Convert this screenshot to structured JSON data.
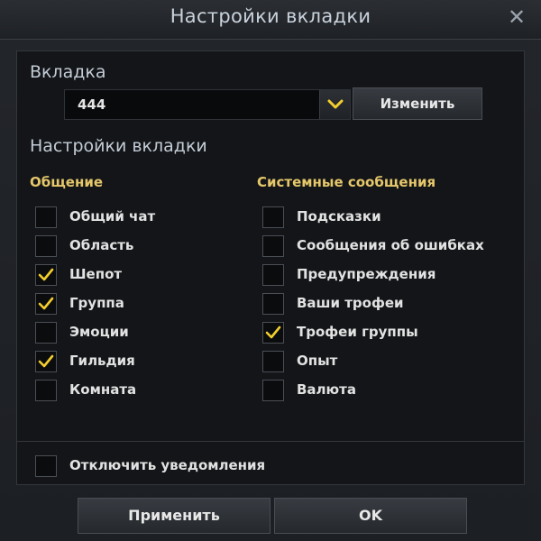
{
  "window": {
    "title": "Настройки вкладки"
  },
  "tab": {
    "label": "Вкладка",
    "selected": "444",
    "change_label": "Изменить"
  },
  "settings": {
    "label": "Настройки вкладки",
    "chat": {
      "header": "Общение",
      "items": [
        {
          "label": "Общий чат",
          "checked": false
        },
        {
          "label": "Область",
          "checked": false
        },
        {
          "label": "Шепот",
          "checked": true
        },
        {
          "label": "Группа",
          "checked": true
        },
        {
          "label": "Эмоции",
          "checked": false
        },
        {
          "label": "Гильдия",
          "checked": true
        },
        {
          "label": "Комната",
          "checked": false
        }
      ]
    },
    "system": {
      "header": "Системные сообщения",
      "items": [
        {
          "label": "Подсказки",
          "checked": false
        },
        {
          "label": "Сообщения об ошибках",
          "checked": false
        },
        {
          "label": "Предупреждения",
          "checked": false
        },
        {
          "label": "Ваши трофеи",
          "checked": false
        },
        {
          "label": "Трофеи группы",
          "checked": true
        },
        {
          "label": "Опыт",
          "checked": false
        },
        {
          "label": "Валюта",
          "checked": false
        }
      ]
    },
    "mute": {
      "label": "Отключить уведомления",
      "checked": false
    }
  },
  "footer": {
    "apply_label": "Применить",
    "ok_label": "OK"
  },
  "colors": {
    "accent": "#e6c76a",
    "check": "#f2cf2e"
  },
  "icons": {
    "close": "close-icon",
    "dropdown": "chevron-down-icon",
    "check": "checkmark-icon"
  }
}
